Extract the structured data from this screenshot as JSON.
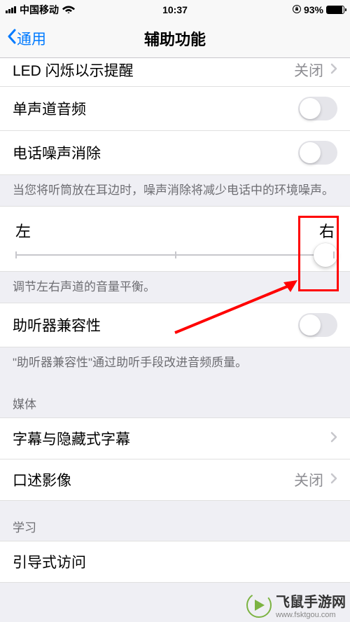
{
  "status_bar": {
    "carrier": "中国移动",
    "time": "10:37",
    "battery_percent": "93%"
  },
  "nav": {
    "back_label": "通用",
    "title": "辅助功能"
  },
  "items": {
    "led_flash": {
      "label": "LED 闪烁以示提醒",
      "value": "关闭"
    },
    "mono_audio": {
      "label": "单声道音频"
    },
    "noise_cancel": {
      "label": "电话噪声消除"
    },
    "noise_cancel_footer": "当您将听筒放在耳边时，噪声消除将减少电话中的环境噪声。",
    "balance": {
      "left": "左",
      "right": "右",
      "footer": "调节左右声道的音量平衡。"
    },
    "hearing_aid": {
      "label": "助听器兼容性",
      "footer": "\"助听器兼容性\"通过助听手段改进音频质量。"
    },
    "media_header": "媒体",
    "subtitles": {
      "label": "字幕与隐藏式字幕"
    },
    "audio_desc": {
      "label": "口述影像",
      "value": "关闭"
    },
    "learning_header": "学习",
    "guided_access": {
      "label": "引导式访问"
    }
  },
  "watermark": {
    "title": "飞鼠手游网",
    "url": "www.fsktgou.com"
  }
}
